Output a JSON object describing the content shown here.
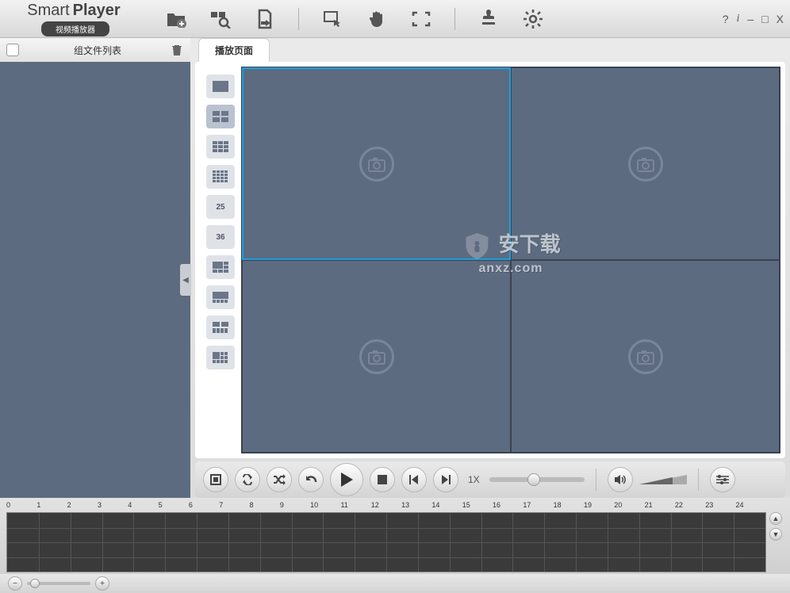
{
  "app": {
    "name_light": "Smart",
    "name_bold": "Player",
    "subtitle": "视频播放器"
  },
  "toolbar": {
    "icons": [
      "folder-add",
      "search",
      "export",
      "region-select",
      "hand",
      "fullscreen",
      "stamp",
      "settings"
    ]
  },
  "window": {
    "help": "?",
    "info": "i",
    "min": "–",
    "max": "□",
    "close": "X"
  },
  "sidebar": {
    "title": "组文件列表"
  },
  "tab": {
    "label": "播放页面"
  },
  "layouts": [
    {
      "id": "1",
      "text": ""
    },
    {
      "id": "4",
      "text": ""
    },
    {
      "id": "9",
      "text": ""
    },
    {
      "id": "16",
      "text": ""
    },
    {
      "id": "25",
      "text": "25"
    },
    {
      "id": "36",
      "text": "36"
    },
    {
      "id": "l7",
      "text": ""
    },
    {
      "id": "l8",
      "text": ""
    },
    {
      "id": "l9",
      "text": ""
    },
    {
      "id": "l10",
      "text": ""
    }
  ],
  "watermark": {
    "main": "安下载",
    "sub": "anxz.com"
  },
  "playback": {
    "speed": "1X"
  },
  "timeline": {
    "hours": [
      "0",
      "1",
      "2",
      "3",
      "4",
      "5",
      "6",
      "7",
      "8",
      "9",
      "10",
      "11",
      "12",
      "13",
      "14",
      "15",
      "16",
      "17",
      "18",
      "19",
      "20",
      "21",
      "22",
      "23",
      "24"
    ]
  }
}
